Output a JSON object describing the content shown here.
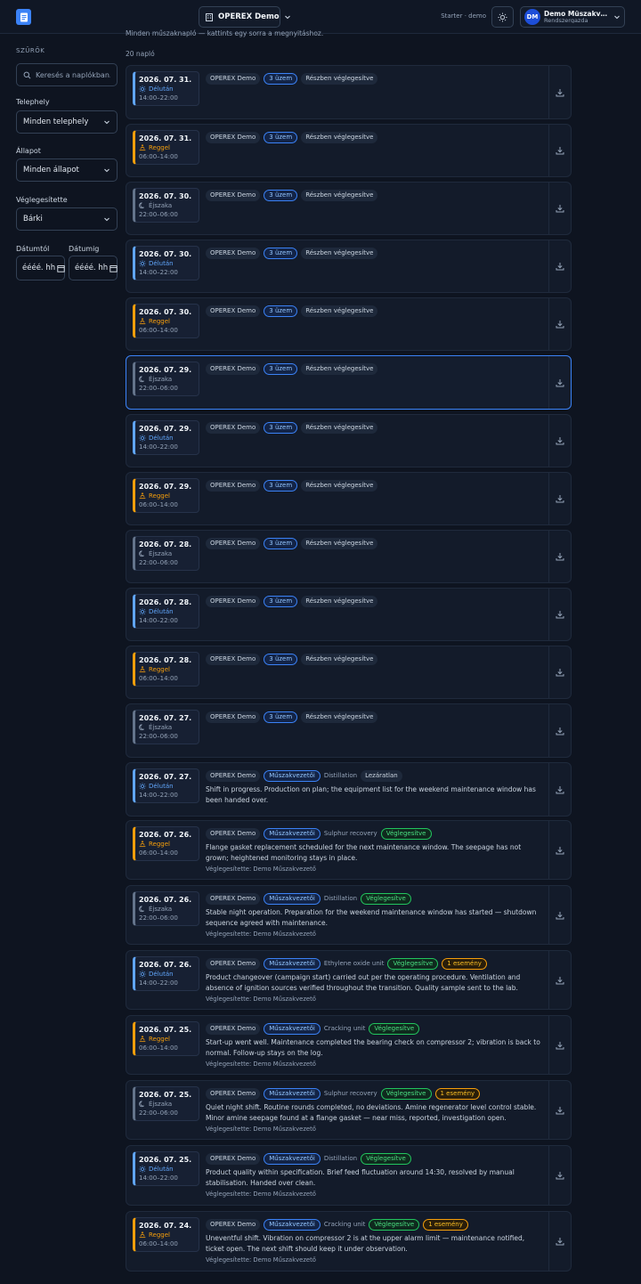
{
  "header": {
    "org": "OPEREX Demo",
    "plan": "Starter · demo",
    "user": {
      "initials": "DM",
      "name": "Demo Műszakvez…",
      "role": "Rendszergazda"
    }
  },
  "filters": {
    "title": "SZŰRŐK",
    "search_placeholder": "Keresés a naplókban...",
    "site_label": "Telephely",
    "site_value": "Minden telephely",
    "status_label": "Állapot",
    "status_value": "Minden állapot",
    "finalizer_label": "Véglegesítette",
    "finalizer_value": "Bárki",
    "date_from_label": "Dátumtól",
    "date_to_label": "Dátumig",
    "date_from_value": "éééé. hh",
    "date_to_value": "éééé. hh"
  },
  "main": {
    "subtitle": "Minden műszaknapló — kattints egy sorra a megnyitáshoz.",
    "count": "20 napló"
  },
  "logs": [
    {
      "date": "2026. 07. 31.",
      "shift": "Délután",
      "shift_type": "afternoon",
      "time": "14:00–22:00",
      "site": "OPEREX Demo",
      "scope": "3 üzem",
      "unit": "",
      "status": "Részben véglegesítve",
      "status_type": "partial",
      "event": "",
      "desc": "",
      "finalizer": ""
    },
    {
      "date": "2026. 07. 31.",
      "shift": "Reggel",
      "shift_type": "morning",
      "time": "06:00–14:00",
      "site": "OPEREX Demo",
      "scope": "3 üzem",
      "unit": "",
      "status": "Részben véglegesítve",
      "status_type": "partial",
      "event": "",
      "desc": "",
      "finalizer": ""
    },
    {
      "date": "2026. 07. 30.",
      "shift": "Éjszaka",
      "shift_type": "night",
      "time": "22:00–06:00",
      "site": "OPEREX Demo",
      "scope": "3 üzem",
      "unit": "",
      "status": "Részben véglegesítve",
      "status_type": "partial",
      "event": "",
      "desc": "",
      "finalizer": ""
    },
    {
      "date": "2026. 07. 30.",
      "shift": "Délután",
      "shift_type": "afternoon",
      "time": "14:00–22:00",
      "site": "OPEREX Demo",
      "scope": "3 üzem",
      "unit": "",
      "status": "Részben véglegesítve",
      "status_type": "partial",
      "event": "",
      "desc": "",
      "finalizer": ""
    },
    {
      "date": "2026. 07. 30.",
      "shift": "Reggel",
      "shift_type": "morning",
      "time": "06:00–14:00",
      "site": "OPEREX Demo",
      "scope": "3 üzem",
      "unit": "",
      "status": "Részben véglegesítve",
      "status_type": "partial",
      "event": "",
      "desc": "",
      "finalizer": ""
    },
    {
      "date": "2026. 07. 29.",
      "shift": "Éjszaka",
      "shift_type": "night",
      "time": "22:00–06:00",
      "site": "OPEREX Demo",
      "scope": "3 üzem",
      "unit": "",
      "status": "Részben véglegesítve",
      "status_type": "partial",
      "event": "",
      "desc": "",
      "finalizer": "",
      "selected": true
    },
    {
      "date": "2026. 07. 29.",
      "shift": "Délután",
      "shift_type": "afternoon",
      "time": "14:00–22:00",
      "site": "OPEREX Demo",
      "scope": "3 üzem",
      "unit": "",
      "status": "Részben véglegesítve",
      "status_type": "partial",
      "event": "",
      "desc": "",
      "finalizer": ""
    },
    {
      "date": "2026. 07. 29.",
      "shift": "Reggel",
      "shift_type": "morning",
      "time": "06:00–14:00",
      "site": "OPEREX Demo",
      "scope": "3 üzem",
      "unit": "",
      "status": "Részben véglegesítve",
      "status_type": "partial",
      "event": "",
      "desc": "",
      "finalizer": ""
    },
    {
      "date": "2026. 07. 28.",
      "shift": "Éjszaka",
      "shift_type": "night",
      "time": "22:00–06:00",
      "site": "OPEREX Demo",
      "scope": "3 üzem",
      "unit": "",
      "status": "Részben véglegesítve",
      "status_type": "partial",
      "event": "",
      "desc": "",
      "finalizer": ""
    },
    {
      "date": "2026. 07. 28.",
      "shift": "Délután",
      "shift_type": "afternoon",
      "time": "14:00–22:00",
      "site": "OPEREX Demo",
      "scope": "3 üzem",
      "unit": "",
      "status": "Részben véglegesítve",
      "status_type": "partial",
      "event": "",
      "desc": "",
      "finalizer": ""
    },
    {
      "date": "2026. 07. 28.",
      "shift": "Reggel",
      "shift_type": "morning",
      "time": "06:00–14:00",
      "site": "OPEREX Demo",
      "scope": "3 üzem",
      "unit": "",
      "status": "Részben véglegesítve",
      "status_type": "partial",
      "event": "",
      "desc": "",
      "finalizer": ""
    },
    {
      "date": "2026. 07. 27.",
      "shift": "Éjszaka",
      "shift_type": "night",
      "time": "22:00–06:00",
      "site": "OPEREX Demo",
      "scope": "3 üzem",
      "unit": "",
      "status": "Részben véglegesítve",
      "status_type": "partial",
      "event": "",
      "desc": "",
      "finalizer": ""
    },
    {
      "date": "2026. 07. 27.",
      "shift": "Délután",
      "shift_type": "afternoon",
      "time": "14:00–22:00",
      "site": "OPEREX Demo",
      "scope": "Műszakvezetői",
      "unit": "Distillation",
      "status": "Lezáratlan",
      "status_type": "open",
      "event": "",
      "desc": "Shift in progress. Production on plan; the equipment list for the weekend maintenance window has been handed over.",
      "finalizer": ""
    },
    {
      "date": "2026. 07. 26.",
      "shift": "Reggel",
      "shift_type": "morning",
      "time": "06:00–14:00",
      "site": "OPEREX Demo",
      "scope": "Műszakvezetői",
      "unit": "Sulphur recovery",
      "status": "Véglegesítve",
      "status_type": "final",
      "event": "",
      "desc": "Flange gasket replacement scheduled for the next maintenance window. The seepage has not grown; heightened monitoring stays in place.",
      "finalizer": "Véglegesítette: Demo Műszakvezető"
    },
    {
      "date": "2026. 07. 26.",
      "shift": "Éjszaka",
      "shift_type": "night",
      "time": "22:00–06:00",
      "site": "OPEREX Demo",
      "scope": "Műszakvezetői",
      "unit": "Distillation",
      "status": "Véglegesítve",
      "status_type": "final",
      "event": "",
      "desc": "Stable night operation. Preparation for the weekend maintenance window has started — shutdown sequence agreed with maintenance.",
      "finalizer": "Véglegesítette: Demo Műszakvezető"
    },
    {
      "date": "2026. 07. 26.",
      "shift": "Délután",
      "shift_type": "afternoon",
      "time": "14:00–22:00",
      "site": "OPEREX Demo",
      "scope": "Műszakvezetői",
      "unit": "Ethylene oxide unit",
      "status": "Véglegesítve",
      "status_type": "final",
      "event": "1 esemény",
      "desc": "Product changeover (campaign start) carried out per the operating procedure. Ventilation and absence of ignition sources verified throughout the transition. Quality sample sent to the lab.",
      "finalizer": "Véglegesítette: Demo Műszakvezető"
    },
    {
      "date": "2026. 07. 25.",
      "shift": "Reggel",
      "shift_type": "morning",
      "time": "06:00–14:00",
      "site": "OPEREX Demo",
      "scope": "Műszakvezetői",
      "unit": "Cracking unit",
      "status": "Véglegesítve",
      "status_type": "final",
      "event": "",
      "desc": "Start-up went well. Maintenance completed the bearing check on compressor 2; vibration is back to normal. Follow-up stays on the log.",
      "finalizer": "Véglegesítette: Demo Műszakvezető"
    },
    {
      "date": "2026. 07. 25.",
      "shift": "Éjszaka",
      "shift_type": "night",
      "time": "22:00–06:00",
      "site": "OPEREX Demo",
      "scope": "Műszakvezetői",
      "unit": "Sulphur recovery",
      "status": "Véglegesítve",
      "status_type": "final",
      "event": "1 esemény",
      "desc": "Quiet night shift. Routine rounds completed, no deviations. Amine regenerator level control stable. Minor amine seepage found at a flange gasket — near miss, reported, investigation open.",
      "finalizer": "Véglegesítette: Demo Műszakvezető"
    },
    {
      "date": "2026. 07. 25.",
      "shift": "Délután",
      "shift_type": "afternoon",
      "time": "14:00–22:00",
      "site": "OPEREX Demo",
      "scope": "Műszakvezetői",
      "unit": "Distillation",
      "status": "Véglegesítve",
      "status_type": "final",
      "event": "",
      "desc": "Product quality within specification. Brief feed fluctuation around 14:30, resolved by manual stabilisation. Handed over clean.",
      "finalizer": "Véglegesítette: Demo Műszakvezető"
    },
    {
      "date": "2026. 07. 24.",
      "shift": "Reggel",
      "shift_type": "morning",
      "time": "06:00–14:00",
      "site": "OPEREX Demo",
      "scope": "Műszakvezetői",
      "unit": "Cracking unit",
      "status": "Véglegesítve",
      "status_type": "final",
      "event": "1 esemény",
      "desc": "Uneventful shift. Vibration on compressor 2 is at the upper alarm limit — maintenance notified, ticket open. The next shift should keep it under observation.",
      "finalizer": "Véglegesítette: Demo Műszakvezető"
    }
  ]
}
